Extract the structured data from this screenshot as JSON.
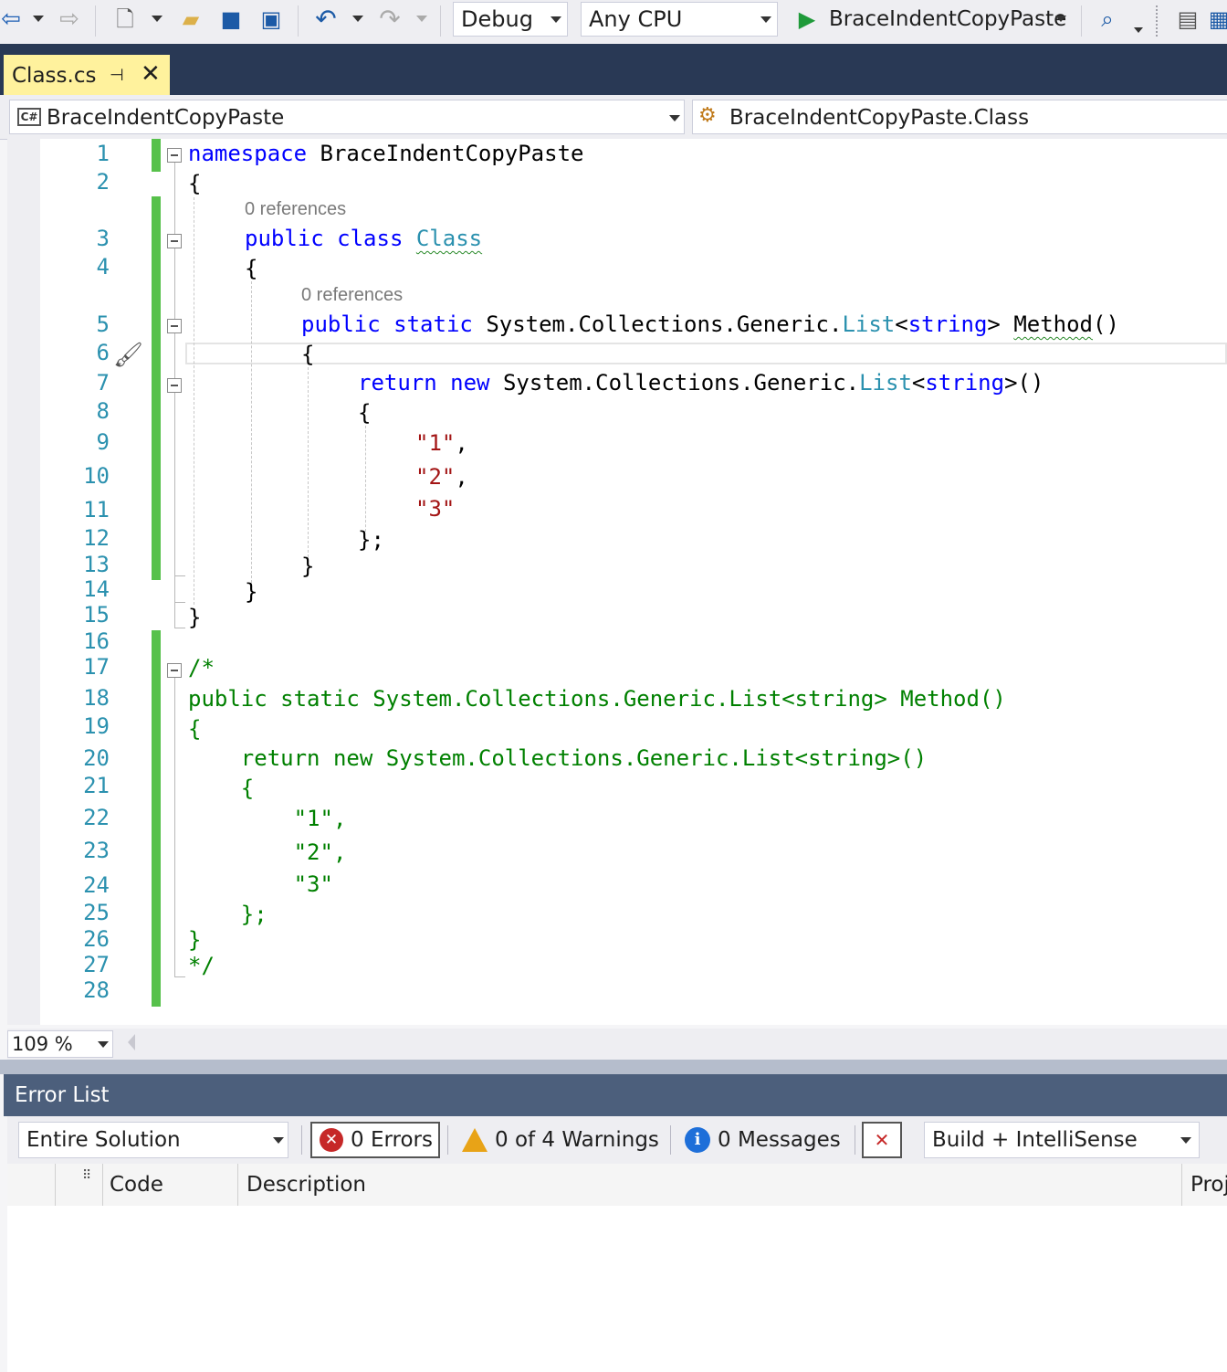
{
  "toolbar": {
    "configuration": "Debug",
    "platform": "Any CPU",
    "start_target": "BraceIndentCopyPaste",
    "icons": [
      "back-icon",
      "forward-icon",
      "new-project-icon",
      "open-folder-icon",
      "save-icon",
      "save-all-icon",
      "undo-icon",
      "redo-icon",
      "start-icon",
      "solution-explorer-icon",
      "properties-icon"
    ]
  },
  "tab": {
    "label": "Class.cs"
  },
  "nav": {
    "project": "BraceIndentCopyPaste",
    "type": "BraceIndentCopyPaste.Class",
    "project_badge": "C#"
  },
  "editor": {
    "line_numbers": [
      "1",
      "2",
      "3",
      "4",
      "5",
      "6",
      "7",
      "8",
      "9",
      "10",
      "11",
      "12",
      "13",
      "14",
      "15",
      "16",
      "17",
      "18",
      "19",
      "20",
      "21",
      "22",
      "23",
      "24",
      "25",
      "26",
      "27",
      "28"
    ],
    "codelens_class": "0 references",
    "codelens_method": "0 references",
    "kw_namespace": "namespace",
    "namespace_name": " BraceIndentCopyPaste",
    "kw_public": "public",
    "kw_class": "class",
    "kw_static": "static",
    "kw_return": "return",
    "kw_new": "new",
    "type_class": "Class",
    "type_list": "List",
    "kw_string": "string",
    "sys_prefix": "System.Collections.Generic.",
    "method_name": "Method",
    "open_brace": "{",
    "close_brace": "}",
    "close_brace_semi": "};",
    "str1": "\"1\"",
    "str2": "\"2\"",
    "str3": "\"3\"",
    "comma": ",",
    "comment_lines": [
      "/*",
      "public static System.Collections.Generic.List<string> Method()",
      "{",
      "    return new System.Collections.Generic.List<string>()",
      "    {",
      "        \"1\",",
      "        \"2\",",
      "        \"3\"",
      "    };",
      "}",
      "*/"
    ]
  },
  "status": {
    "zoom": "109 %"
  },
  "error_list": {
    "title": "Error List",
    "scope": "Entire Solution",
    "errors": "0 Errors",
    "warnings": "0 of 4 Warnings",
    "messages": "0 Messages",
    "filter": "Build + IntelliSense",
    "columns": {
      "code": "Code",
      "description": "Description",
      "project": "Proj"
    },
    "colors": {
      "error": "#c62828",
      "warning": "#e8a317",
      "info": "#1e6fd9"
    }
  }
}
